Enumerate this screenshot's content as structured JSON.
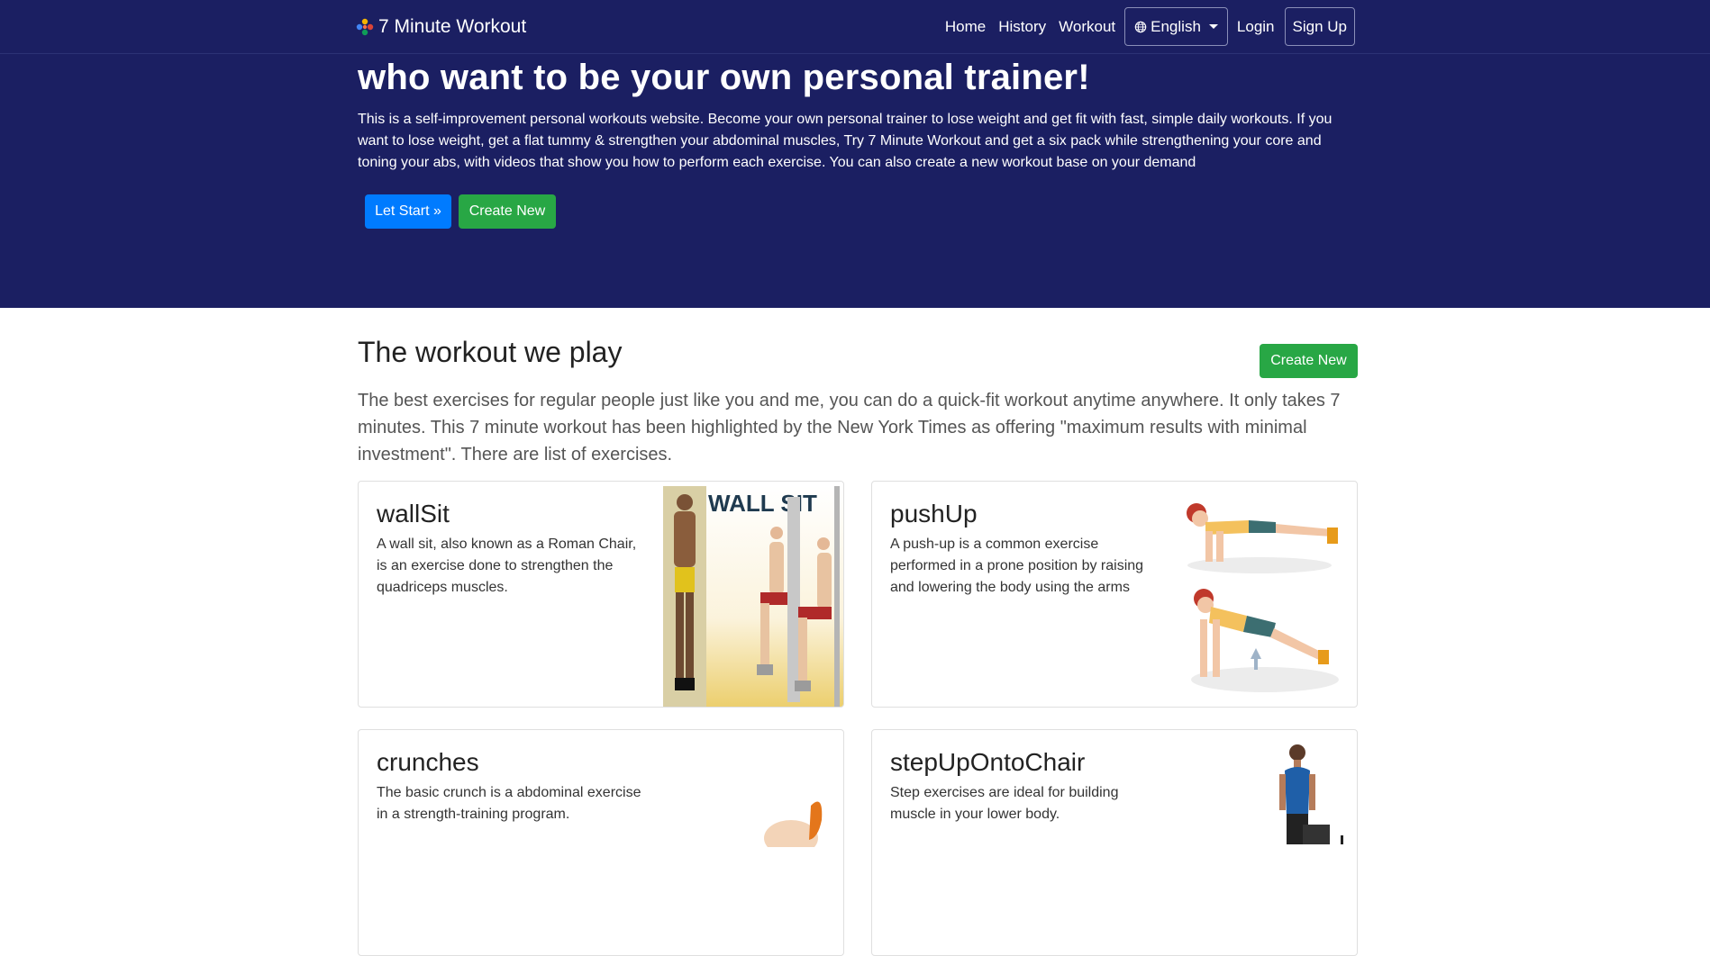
{
  "navbar": {
    "brand": "7 Minute Workout",
    "links": [
      "Home",
      "History",
      "Workout"
    ],
    "language": "English",
    "login": "Login",
    "signup": "Sign Up"
  },
  "hero": {
    "title": "who want to be your own personal trainer!",
    "description": "This is a self-improvement personal workouts website. Become your own personal trainer to lose weight and get fit with fast, simple daily workouts. If you want to lose weight, get a flat tummy & strengthen your abdominal muscles, Try 7 Minute Workout and get a six pack while strengthening your core and toning your abs, with videos that show you how to perform each exercise. You can also create a new workout base on your demand",
    "start_label": "Let Start »",
    "create_label": "Create New"
  },
  "section": {
    "title": "The workout we play",
    "create_label": "Create New",
    "lead": "The best exercises for regular people just like you and me, you can do a quick-fit workout anytime anywhere. It only takes 7 minutes. This 7 minute workout has been highlighted by the New York Times as offering \"maximum results with minimal investment\". There are list of exercises."
  },
  "exercises": [
    {
      "name": "wallSit",
      "description": "A wall sit, also known as a Roman Chair, is an exercise done to strengthen the quadriceps muscles.",
      "image_text": "WALL SIT"
    },
    {
      "name": "pushUp",
      "description": "A push-up is a common exercise performed in a prone position by raising and lowering the body using the arms"
    },
    {
      "name": "crunches",
      "description": "The basic crunch is a abdominal exercise in a strength-training program."
    },
    {
      "name": "stepUpOntoChair",
      "description": "Step exercises are ideal for building muscle in your lower body."
    }
  ],
  "colors": {
    "navy": "#1b1f62",
    "primary": "#007bff",
    "success": "#28a745"
  }
}
